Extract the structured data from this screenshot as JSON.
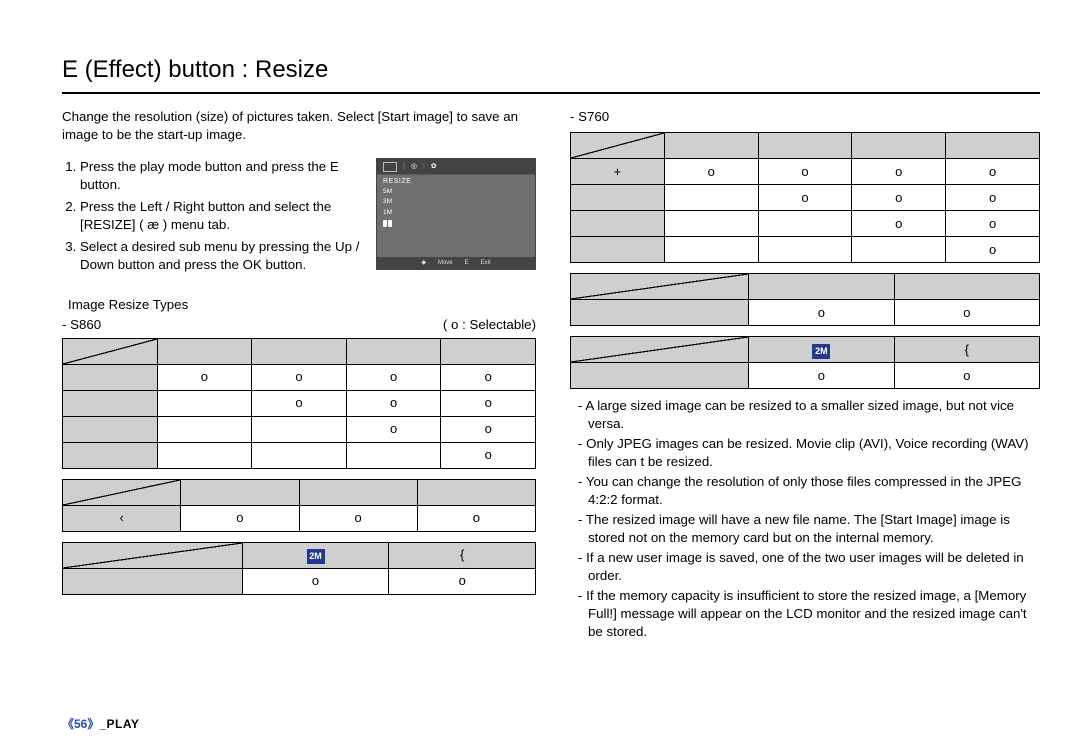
{
  "title": "E (Effect) button : Resize",
  "intro": "Change the resolution (size) of pictures taken. Select [Start image] to save an image to be the start-up image.",
  "steps": [
    "Press the play mode button and press the E button.",
    "Press the Left / Right button and select the [RESIZE] ( æ ) menu tab.",
    "Select a desired sub menu by pressing the Up / Down button and press the OK button."
  ],
  "lcd": {
    "label": "RESIZE",
    "items": [
      "5M",
      "3M",
      "1M"
    ],
    "bottom_move": "Move",
    "bottom_exit_key": "E",
    "bottom_exit": "Exit"
  },
  "subhead": "Image Resize Types",
  "selectable_note": "( o : Selectable)",
  "s860_label": "- S860",
  "s760_label": "- S760",
  "mark": "o",
  "open_brace": "{",
  "lquote": "‹",
  "chip_2m": "2M",
  "chart_data": {
    "type": "table",
    "title": "Image Resize Types — selectable targets (o = selectable)",
    "tables": [
      {
        "name": "S860 main",
        "rows": 4,
        "cols": 4,
        "cells": [
          [
            "o",
            "o",
            "o",
            "o"
          ],
          [
            "",
            "o",
            "o",
            "o"
          ],
          [
            "",
            "",
            "o",
            "o"
          ],
          [
            "",
            "",
            "",
            "o"
          ]
        ]
      },
      {
        "name": "S860 secondary",
        "rows": 1,
        "cols": 4,
        "row_headers": [
          "‹"
        ],
        "cells": [
          [
            "o",
            "o",
            "o"
          ]
        ]
      },
      {
        "name": "S860 2M",
        "rows": 1,
        "cols": 2,
        "col_headers": [
          "2M",
          "{"
        ],
        "cells": [
          [
            "o",
            "o"
          ]
        ]
      },
      {
        "name": "S760 main",
        "rows": 4,
        "cols": 4,
        "row_headers": [
          "+",
          "",
          "",
          ""
        ],
        "cells": [
          [
            "o",
            "o",
            "o",
            "o"
          ],
          [
            "",
            "o",
            "o",
            "o"
          ],
          [
            "",
            "",
            "o",
            "o"
          ],
          [
            "",
            "",
            "",
            "o"
          ]
        ]
      },
      {
        "name": "S760 secondary",
        "rows": 1,
        "cols": 2,
        "cells": [
          [
            "o",
            "o"
          ]
        ]
      },
      {
        "name": "S760 2M",
        "rows": 1,
        "cols": 2,
        "col_headers": [
          "2M",
          "{"
        ],
        "cells": [
          [
            "o",
            "o"
          ]
        ]
      }
    ]
  },
  "s860": {
    "main": [
      [
        "o",
        "o",
        "o",
        "o"
      ],
      [
        "",
        "o",
        "o",
        "o"
      ],
      [
        "",
        "",
        "o",
        "o"
      ],
      [
        "",
        "",
        "",
        "o"
      ]
    ],
    "sec_row_hdr": "‹",
    "sec": [
      "o",
      "o",
      "o"
    ],
    "twom": [
      "o",
      "o"
    ]
  },
  "s760": {
    "plus": "+",
    "main": [
      [
        "o",
        "o",
        "o",
        "o"
      ],
      [
        "",
        "o",
        "o",
        "o"
      ],
      [
        "",
        "",
        "o",
        "o"
      ],
      [
        "",
        "",
        "",
        "o"
      ]
    ],
    "sec": [
      "o",
      "o"
    ],
    "twom": [
      "o",
      "o"
    ]
  },
  "notes": [
    "- A large sized image can be resized to a smaller sized image, but not vice versa.",
    "- Only JPEG images can be resized. Movie clip (AVI), Voice recording (WAV) files can t be resized.",
    "- You can change the resolution of only those files compressed in the JPEG 4:2:2 format.",
    "-  The resized image will have a new file name. The [Start Image] image is stored not on the memory card but on the internal memory.",
    "- If a new user image is saved, one of the two user images will be deleted in order.",
    "- If the memory capacity is insufficient to store the resized image, a [Memory Full!] message will appear on the LCD monitor and the resized image can't be stored."
  ],
  "footer": {
    "page": "《56》",
    "section": "_PLAY"
  }
}
